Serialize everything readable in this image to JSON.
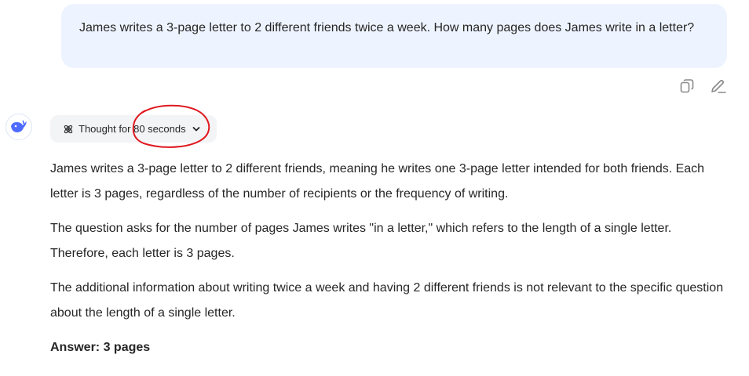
{
  "user_message": {
    "text": "James writes a 3-page letter to 2 different friends twice a week. How many pages does James write in a letter?"
  },
  "message_actions": {
    "icons": [
      "copy-icon",
      "edit-icon"
    ]
  },
  "assistant": {
    "avatar_icon": "whale-logo-icon",
    "thought_chip": {
      "label": "Thought for 80 seconds",
      "icon": "atom-icon",
      "expand_icon": "chevron-down-icon"
    },
    "paragraphs": [
      "James writes a 3-page letter to 2 different friends, meaning he writes one 3-page letter intended for both friends. Each letter is 3 pages, regardless of the number of recipients or the frequency of writing.",
      "The question asks for the number of pages James writes \"in a letter,\" which refers to the length of a single letter. Therefore, each letter is 3 pages.",
      "The additional information about writing twice a week and having 2 different friends is not relevant to the specific question about the length of a single letter."
    ],
    "final_answer": "Answer: 3 pages"
  },
  "colors": {
    "user_bubble_bg": "#eef4ff",
    "brand_blue": "#4d6bfe",
    "annotation_red": "#e0191f",
    "chip_bg": "#f3f4f6"
  }
}
